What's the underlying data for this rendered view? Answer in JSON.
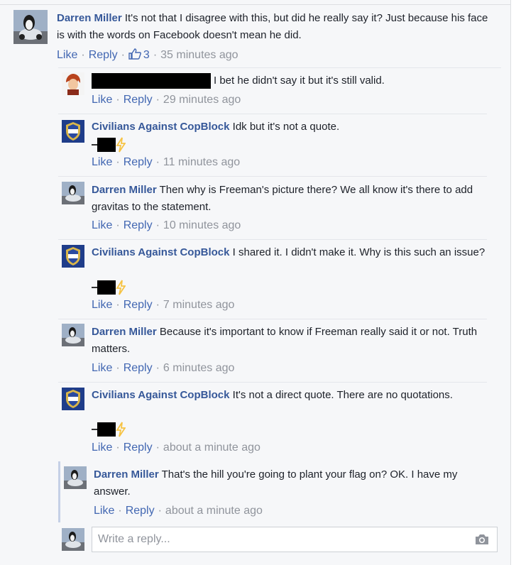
{
  "comments": [
    {
      "author": "Darren Miller",
      "text": "It's not that I disagree with this, but did he really say it? Just because his face is with the words on Facebook doesn't mean he did.",
      "like": "Like",
      "reply": "Reply",
      "likes_count": "3",
      "time": "35 minutes ago",
      "avatar": "penguin-car-avatar"
    },
    {
      "author": "",
      "text": "I bet he didn't say it but it's still valid.",
      "like": "Like",
      "reply": "Reply",
      "time": "29 minutes ago",
      "avatar": "redhead-cartoon-avatar"
    },
    {
      "author": "Civilians Against CopBlock",
      "text": "Idk but it's not a quote.",
      "like": "Like",
      "reply": "Reply",
      "time": "11 minutes ago",
      "avatar": "stand-with-cops-badge-avatar"
    },
    {
      "author": "Darren Miller",
      "text": "Then why is Freeman's picture there? We all know it's there to add gravitas to the statement.",
      "like": "Like",
      "reply": "Reply",
      "time": "10 minutes ago",
      "avatar": "penguin-car-avatar"
    },
    {
      "author": "Civilians Against CopBlock",
      "text": "I shared it. I didn't make it. Why is this such an issue?",
      "like": "Like",
      "reply": "Reply",
      "time": "7 minutes ago",
      "avatar": "stand-with-cops-badge-avatar"
    },
    {
      "author": "Darren Miller",
      "text": "Because it's important to know if Freeman really said it or not. Truth matters.",
      "like": "Like",
      "reply": "Reply",
      "time": "6 minutes ago",
      "avatar": "penguin-car-avatar"
    },
    {
      "author": "Civilians Against CopBlock",
      "text": "It's not a direct quote. There are no quotations.",
      "like": "Like",
      "reply": "Reply",
      "time": "about a minute ago",
      "avatar": "stand-with-cops-badge-avatar"
    },
    {
      "author": "Darren Miller",
      "text": "That's the hill you're going to plant your flag on? OK. I have my answer.",
      "like": "Like",
      "reply": "Reply",
      "time": "about a minute ago",
      "avatar": "penguin-car-avatar"
    }
  ],
  "reply_box": {
    "placeholder": "Write a reply...",
    "camera_icon": "camera-icon"
  },
  "colors": {
    "author": "#365899",
    "link": "#4267b2",
    "meta": "#90949c",
    "text": "#1d2129",
    "lightning": "#f6c344"
  }
}
